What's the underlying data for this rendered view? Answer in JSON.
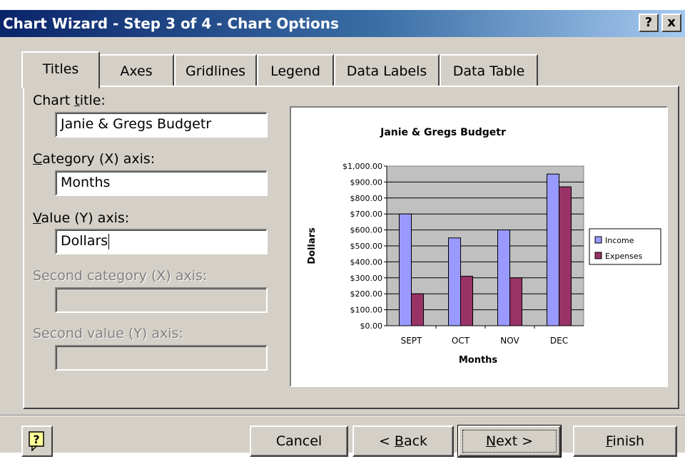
{
  "window": {
    "title": "Chart Wizard - Step 3 of 4 - Chart Options",
    "help_glyph": "?",
    "close_glyph": "x"
  },
  "tabs": [
    {
      "label": "Titles",
      "active": true
    },
    {
      "label": "Axes"
    },
    {
      "label": "Gridlines"
    },
    {
      "label": "Legend"
    },
    {
      "label": "Data Labels"
    },
    {
      "label": "Data Table"
    }
  ],
  "fields": {
    "chart_title": {
      "label_pre": "Chart ",
      "label_key": "t",
      "label_post": "itle:",
      "value": "Janie & Gregs Budgetr"
    },
    "category_x": {
      "label_pre": "",
      "label_key": "C",
      "label_post": "ategory (X) axis:",
      "value": "Months"
    },
    "value_y": {
      "label_pre": "",
      "label_key": "V",
      "label_post": "alue (Y) axis:",
      "value": "Dollars"
    },
    "second_category_x": {
      "label": "Second category (X) axis:",
      "value": ""
    },
    "second_value_y": {
      "label": "Second value (Y) axis:",
      "value": ""
    }
  },
  "buttons": {
    "help_icon": "help-icon",
    "cancel": "Cancel",
    "back": {
      "pre": "< ",
      "key": "B",
      "post": "ack"
    },
    "next": {
      "pre": "",
      "key": "N",
      "post": "ext >"
    },
    "finish": {
      "pre": "",
      "key": "F",
      "post": "inish"
    }
  },
  "colors": {
    "income": "#9999ff",
    "expenses": "#993366",
    "plot_area": "#c0c0c0",
    "titlebar_start": "#0a246a",
    "titlebar_end": "#a6caf0"
  },
  "chart_data": {
    "type": "bar",
    "title": "Janie & Gregs Budgetr",
    "xlabel": "Months",
    "ylabel": "Dollars",
    "categories": [
      "SEPT",
      "OCT",
      "NOV",
      "DEC"
    ],
    "series": [
      {
        "name": "Income",
        "values": [
          700,
          550,
          600,
          950
        ]
      },
      {
        "name": "Expenses",
        "values": [
          200,
          310,
          300,
          870
        ]
      }
    ],
    "ylim": [
      0,
      1000
    ],
    "yticks": [
      "$0.00",
      "$100.00",
      "$200.00",
      "$300.00",
      "$400.00",
      "$500.00",
      "$600.00",
      "$700.00",
      "$800.00",
      "$900.00",
      "$1,000.00"
    ],
    "grid": true,
    "legend": "right"
  }
}
